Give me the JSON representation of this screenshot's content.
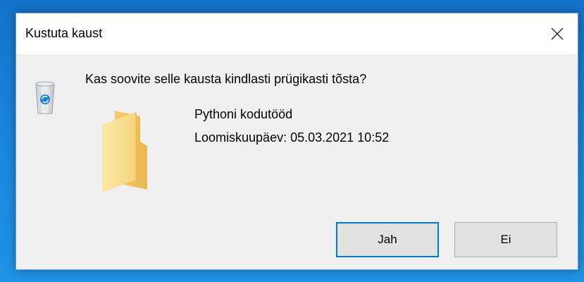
{
  "dialog": {
    "title": "Kustuta kaust",
    "question": "Kas soovite selle kausta kindlasti prügikasti tõsta?",
    "item": {
      "name": "Pythoni kodutööd",
      "created": "Loomiskuupäev: 05.03.2021 10:52"
    },
    "buttons": {
      "yes": "Jah",
      "no": "Ei"
    },
    "icons": {
      "close": "close-icon",
      "recycle": "recycle-bin-icon",
      "folder": "folder-icon"
    }
  },
  "colors": {
    "desktop": "#1a84dc",
    "dialog_bg": "#f0f0f0",
    "default_button_border": "#0078d7"
  }
}
